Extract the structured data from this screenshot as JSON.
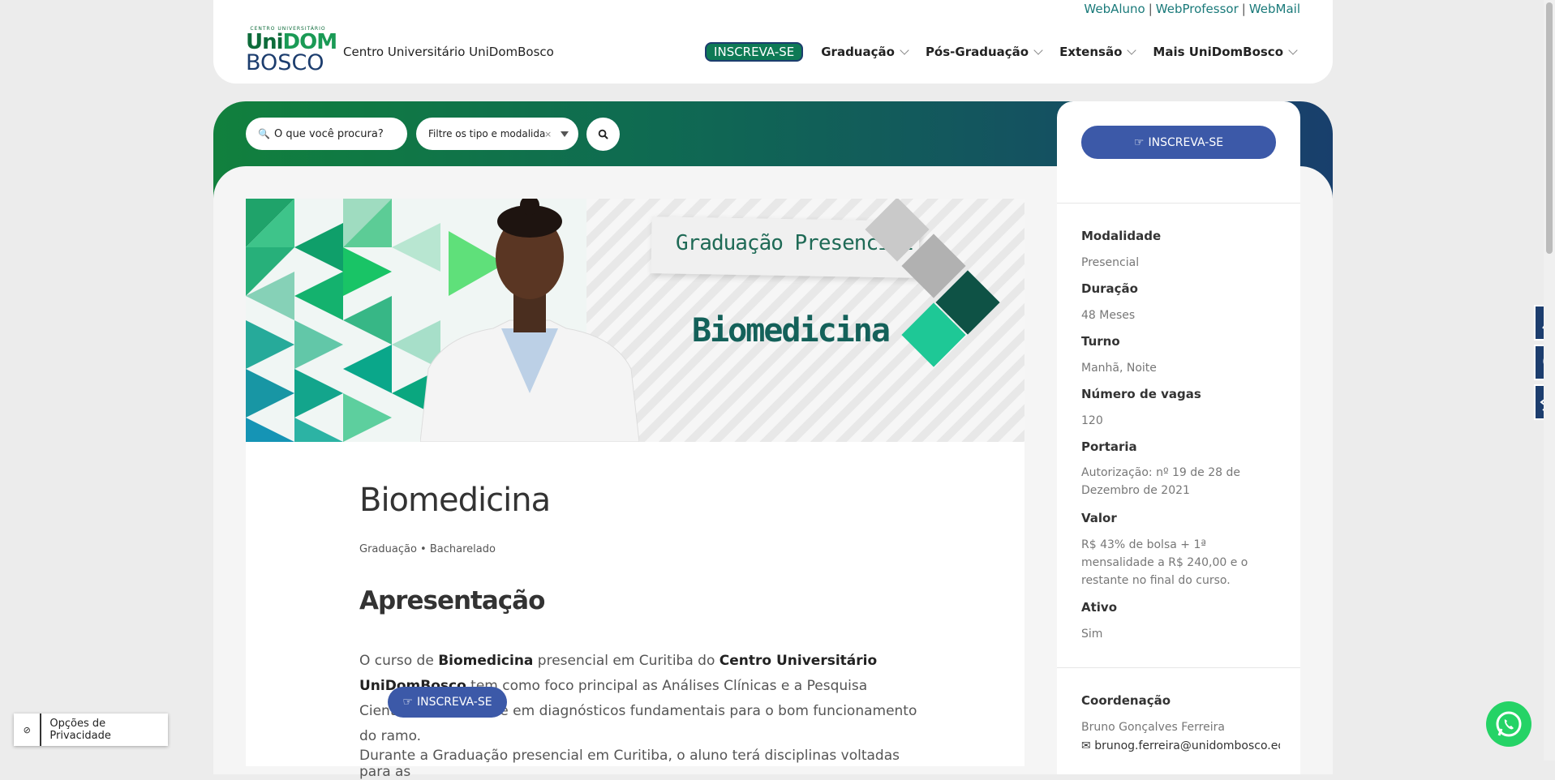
{
  "header": {
    "toplinks": [
      "WebAluno",
      "WebProfessor",
      "WebMail"
    ],
    "logo": {
      "tiny": "CENTRO UNIVERSITÁRIO",
      "uni": "Uni",
      "dom": "DOM",
      "bosco": "BOSCO"
    },
    "site_title": "Centro Universitário UniDomBosco",
    "nav": {
      "cta": "INSCREVA-SE",
      "items": [
        "Graduação",
        "Pós-Graduação",
        "Extensão",
        "Mais UniDomBosco"
      ]
    }
  },
  "search": {
    "placeholder": "O que você procura?",
    "filter_placeholder": "Filtre os tipo e modalidade",
    "clear": "×"
  },
  "banner": {
    "subtitle": "Graduação Presencial",
    "title": "Biomedicina"
  },
  "course": {
    "title": "Biomedicina",
    "meta": "Graduação • Bacharelado",
    "section_title": "Apresentação",
    "para1": {
      "t1": "O curso de ",
      "b1": "Biomedicina",
      "t2": " presencial em Curitiba do ",
      "b2": "Centro Universitário UniDomBosco",
      "t3": " tem como foco principal as Análises Clínicas e a Pesquisa Científica com ênfase em diagnósticos fundamentais para o bom funcionamento do ramo."
    },
    "para2": "Durante a Graduação presencial em Curitiba, o aluno terá disciplinas voltadas para as"
  },
  "floating_cta": "INSCREVA-SE",
  "sidebar": {
    "cta": "INSCREVA-SE",
    "fields": [
      {
        "label": "Modalidade",
        "value": "Presencial"
      },
      {
        "label": "Duração",
        "value": "48 Meses"
      },
      {
        "label": "Turno",
        "value": "Manhã, Noite"
      },
      {
        "label": "Número de vagas",
        "value": "120"
      },
      {
        "label": "Portaria",
        "value": "Autorização: nº 19 de 28 de Dezembro de 2021"
      },
      {
        "label": "Valor",
        "value": "R$ 43% de bolsa + 1ª mensalidade a R$ 240,00 e o restante no final do curso."
      },
      {
        "label": "Ativo",
        "value": "Sim"
      }
    ],
    "coordination": {
      "label": "Coordenação",
      "name": "Bruno Gonçalves Ferreira",
      "email": "brunog.ferreira@unidombosco.edu"
    }
  },
  "accessibility": [
    "sign-language-icon",
    "voice-reader-icon",
    "eye-off-icon"
  ],
  "privacy": {
    "label": "Opções de Privacidade"
  },
  "colors": {
    "green": "#0e7a55",
    "navy": "#1c3d6e",
    "blue_btn": "#3c59a8",
    "link": "#1a7a7a"
  }
}
